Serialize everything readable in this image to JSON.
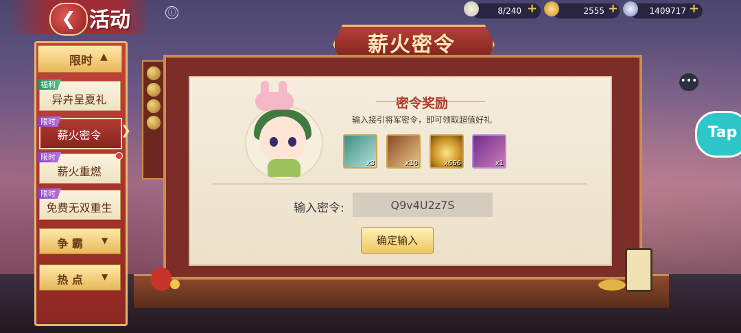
{
  "header": {
    "page_title": "活动",
    "back_icon": "back-arrow-icon",
    "info_icon": "ⓘ"
  },
  "resources": [
    {
      "icon": "bun-icon",
      "value": "8/240"
    },
    {
      "icon": "gold-ingot-icon",
      "value": "2555"
    },
    {
      "icon": "silver-coin-icon",
      "value": "1409717"
    }
  ],
  "banner": {
    "title": "薪火密令"
  },
  "sidebar": {
    "category": "限时",
    "items": [
      {
        "badge": "福利",
        "label": "异卉呈夏礼",
        "active": false
      },
      {
        "badge": "限时",
        "label": "薪火密令",
        "active": true
      },
      {
        "badge": "限时",
        "label": "薪火重燃",
        "active": false
      },
      {
        "badge": "限时",
        "label": "免费无双重生",
        "active": false
      }
    ],
    "buttons": [
      {
        "label": "争 霸"
      },
      {
        "label": "热 点"
      }
    ]
  },
  "panel": {
    "reward_title": "密令奖励",
    "reward_subtitle": "输入接引将军密令，即可领取超值好礼",
    "items": [
      {
        "icon": "green-scroll-card-icon",
        "count": "x3"
      },
      {
        "icon": "portrait-scroll-icon",
        "count": "x10"
      },
      {
        "icon": "gold-ingot-icon",
        "count": "x666"
      },
      {
        "icon": "event-badge-icon",
        "count": "x1"
      }
    ],
    "input_label": "输入密令:",
    "code_value": "Q9v4U2z7S",
    "confirm_label": "确定输入"
  },
  "floating": {
    "chat_icon": "chat-bubble-icon",
    "tap_label": "Tap"
  }
}
